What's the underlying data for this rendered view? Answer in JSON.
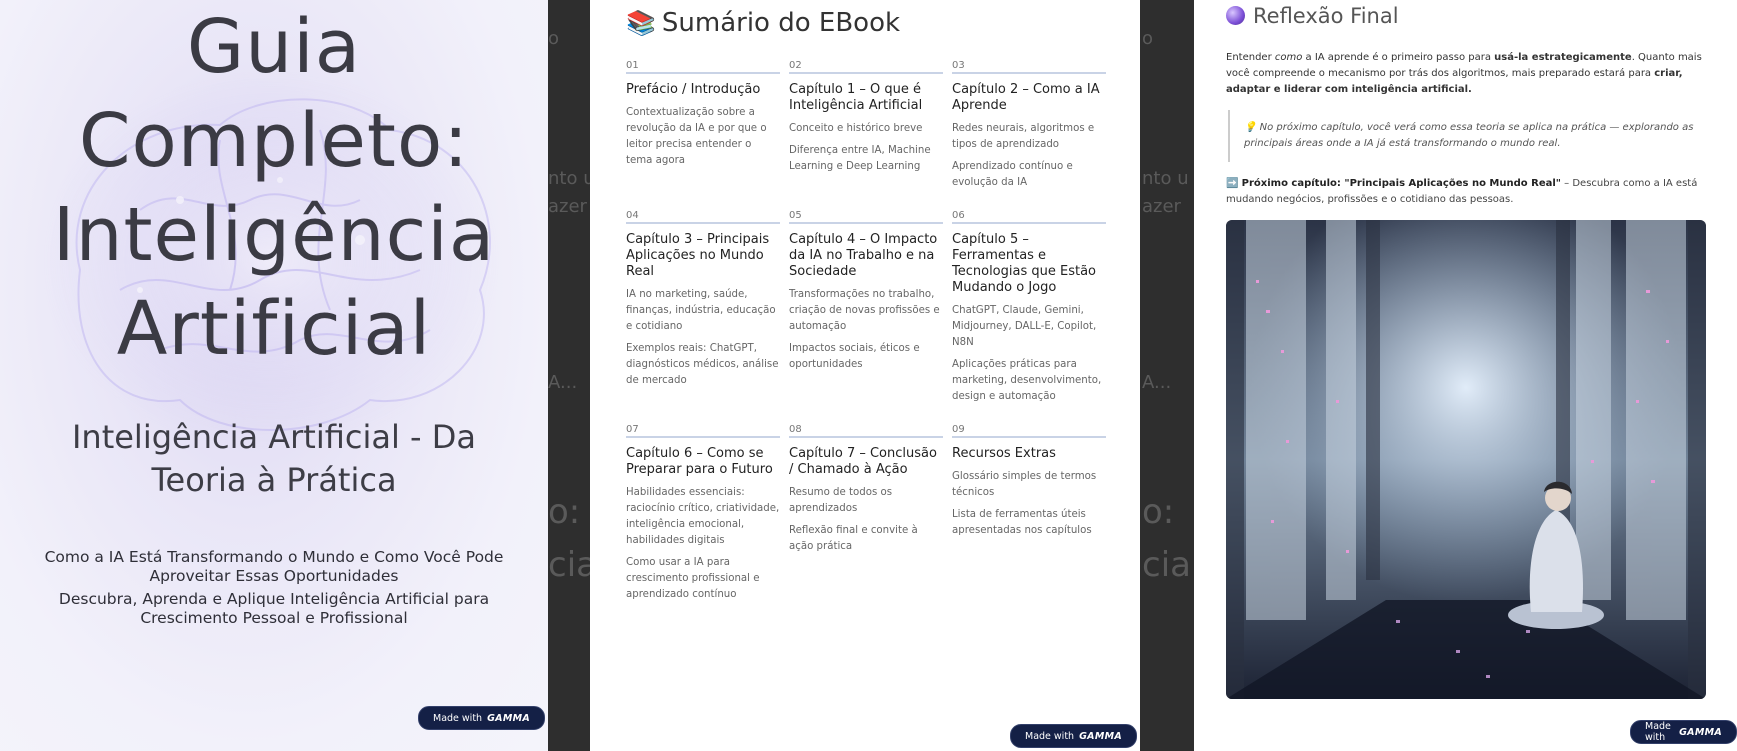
{
  "cover": {
    "title_lines": [
      "Guia",
      "Completo:",
      "Inteligência",
      "Artificial"
    ],
    "subtitle": "Inteligência Artificial - Da Teoria à Prática",
    "desc1": "Como a IA Está Transformando o Mundo e Como Você Pode Aproveitar Essas Oportunidades",
    "desc2": "Descubra, Aprenda e Aplique Inteligência Artificial para Crescimento Pessoal e Profissional"
  },
  "badge": {
    "prefix": "Made with",
    "brand": "GAMMA"
  },
  "ghost": [
    "o",
    "nto u",
    "azer",
    "A...",
    "o:",
    "cia",
    "o",
    "nto u",
    "azer",
    "A...",
    "o:",
    "cia"
  ],
  "toc": {
    "icon": "books-icon",
    "title": "Sumário do EBook",
    "items": [
      {
        "num": "01",
        "title": "Prefácio / Introdução",
        "lines": [
          "Contextualização sobre a revolução da IA e por que o leitor precisa entender o tema agora"
        ]
      },
      {
        "num": "02",
        "title": "Capítulo 1 – O que é Inteligência Artificial",
        "lines": [
          "Conceito e histórico breve",
          "Diferença entre IA, Machine Learning e Deep Learning"
        ]
      },
      {
        "num": "03",
        "title": "Capítulo 2 – Como a IA Aprende",
        "lines": [
          "Redes neurais, algoritmos e tipos de aprendizado",
          "Aprendizado contínuo e evolução da IA"
        ]
      },
      {
        "num": "04",
        "title": "Capítulo 3 – Principais Aplicações no Mundo Real",
        "lines": [
          "IA no marketing, saúde, finanças, indústria, educação e cotidiano",
          "Exemplos reais: ChatGPT, diagnósticos médicos, análise de mercado"
        ]
      },
      {
        "num": "05",
        "title": "Capítulo 4 – O Impacto da IA no Trabalho e na Sociedade",
        "lines": [
          "Transformações no trabalho, criação de novas profissões e automação",
          "Impactos sociais, éticos e oportunidades"
        ]
      },
      {
        "num": "06",
        "title": "Capítulo 5 – Ferramentas e Tecnologias que Estão Mudando o Jogo",
        "lines": [
          "ChatGPT, Claude, Gemini, Midjourney, DALL-E, Copilot, N8N",
          "Aplicações práticas para marketing, desenvolvimento, design e automação"
        ]
      },
      {
        "num": "07",
        "title": "Capítulo 6 – Como se Preparar para o Futuro",
        "lines": [
          "Habilidades essenciais: raciocínio crítico, criatividade, inteligência emocional, habilidades digitais",
          "Como usar a IA para crescimento profissional e aprendizado contínuo"
        ]
      },
      {
        "num": "08",
        "title": "Capítulo 7 – Conclusão / Chamado à Ação",
        "lines": [
          "Resumo de todos os aprendizados",
          "Reflexão final e convite à ação prática"
        ]
      },
      {
        "num": "09",
        "title": "Recursos Extras",
        "lines": [
          "Glossário simples de termos técnicos",
          "Lista de ferramentas úteis apresentadas nos capítulos"
        ]
      }
    ]
  },
  "reflection": {
    "icon": "crystal-ball-icon",
    "title": "Reflexão Final",
    "p1_a": "Entender ",
    "p1_b": "como",
    "p1_c": " a IA aprende é o primeiro passo para ",
    "p1_d": "usá-la estrategicamente",
    "p1_e": ". Quanto mais você compreende o mecanismo por trás dos algoritmos, mais preparado estará para ",
    "p1_f": "criar, adaptar e liderar com inteligência artificial.",
    "quote_icon": "💡",
    "quote": "No próximo capítulo, você verá como essa teoria se aplica na prática — explorando as principais áreas onde a IA já está transformando o mundo real.",
    "next_icon": "➡️",
    "next_label": "Próximo capítulo: \"Principais Aplicações no Mundo Real\"",
    "next_text": " – Descubra como a IA está mudando negócios, profissões e o cotidiano das pessoas.",
    "image_desc": "person-meditating-in-futuristic-corridor"
  }
}
